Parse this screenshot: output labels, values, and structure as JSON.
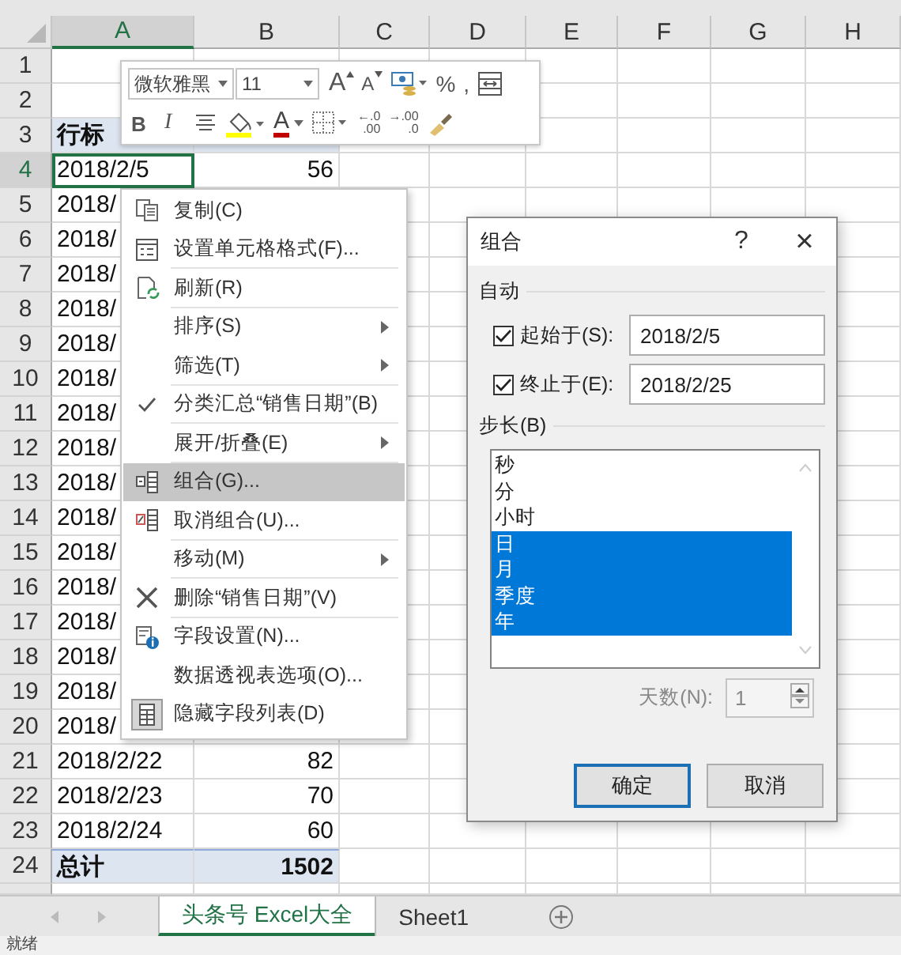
{
  "sheet": {
    "columns": [
      {
        "label": "A",
        "selected": true
      },
      {
        "label": "B",
        "selected": false
      },
      {
        "label": "C",
        "selected": false
      },
      {
        "label": "D",
        "selected": false
      },
      {
        "label": "E",
        "selected": false
      },
      {
        "label": "F",
        "selected": false
      },
      {
        "label": "G",
        "selected": false
      },
      {
        "label": "H",
        "selected": false
      }
    ],
    "rows": [
      {
        "number": "1",
        "kind": "data",
        "selected": false
      },
      {
        "number": "2",
        "kind": "data",
        "selected": false
      },
      {
        "number": "3",
        "kind": "header",
        "selected": false,
        "a": "行标"
      },
      {
        "number": "4",
        "kind": "data",
        "selected": true,
        "a": "2018/2/5",
        "b": "56"
      },
      {
        "number": "5",
        "kind": "data",
        "selected": false,
        "a": "2018/"
      },
      {
        "number": "6",
        "kind": "data",
        "selected": false,
        "a": "2018/"
      },
      {
        "number": "7",
        "kind": "data",
        "selected": false,
        "a": "2018/"
      },
      {
        "number": "8",
        "kind": "data",
        "selected": false,
        "a": "2018/"
      },
      {
        "number": "9",
        "kind": "data",
        "selected": false,
        "a": "2018/"
      },
      {
        "number": "10",
        "kind": "data",
        "selected": false,
        "a": "2018/"
      },
      {
        "number": "11",
        "kind": "data",
        "selected": false,
        "a": "2018/"
      },
      {
        "number": "12",
        "kind": "data",
        "selected": false,
        "a": "2018/"
      },
      {
        "number": "13",
        "kind": "data",
        "selected": false,
        "a": "2018/"
      },
      {
        "number": "14",
        "kind": "data",
        "selected": false,
        "a": "2018/"
      },
      {
        "number": "15",
        "kind": "data",
        "selected": false,
        "a": "2018/"
      },
      {
        "number": "16",
        "kind": "data",
        "selected": false,
        "a": "2018/"
      },
      {
        "number": "17",
        "kind": "data",
        "selected": false,
        "a": "2018/"
      },
      {
        "number": "18",
        "kind": "data",
        "selected": false,
        "a": "2018/"
      },
      {
        "number": "19",
        "kind": "data",
        "selected": false,
        "a": "2018/"
      },
      {
        "number": "20",
        "kind": "data",
        "selected": false,
        "a": "2018/"
      },
      {
        "number": "21",
        "kind": "data",
        "selected": false,
        "a": "2018/2/22",
        "b": "82"
      },
      {
        "number": "22",
        "kind": "data",
        "selected": false,
        "a": "2018/2/23",
        "b": "70"
      },
      {
        "number": "23",
        "kind": "data",
        "selected": false,
        "a": "2018/2/24",
        "b": "60"
      },
      {
        "number": "24",
        "kind": "total",
        "selected": false,
        "a": "总计",
        "b": "1502"
      }
    ]
  },
  "mini_toolbar": {
    "font": "微软雅黑",
    "size": "11",
    "row_1": [
      {
        "kind": "grow",
        "glyph": "A"
      },
      {
        "kind": "shrink",
        "glyph": "A"
      },
      {
        "kind": "currency"
      },
      {
        "kind": "text",
        "glyph": "%"
      },
      {
        "kind": "text",
        "glyph": ","
      },
      {
        "kind": "wrap"
      }
    ],
    "row_2": [
      {
        "kind": "bold",
        "glyph": "B"
      },
      {
        "kind": "italic",
        "glyph": "I"
      },
      {
        "kind": "align"
      },
      {
        "kind": "fill"
      },
      {
        "kind": "fontcolor",
        "glyph": "A"
      },
      {
        "kind": "border"
      },
      {
        "kind": "decimal",
        "top": ".0",
        "bottom": ".00",
        "arrow": "←"
      },
      {
        "kind": "decimal",
        "top": ".00",
        "bottom": ".0",
        "arrow": "→"
      },
      {
        "kind": "painter"
      }
    ]
  },
  "context_menu": [
    {
      "label": "复制(C)",
      "kind": "copy",
      "checked": false,
      "submenu": false,
      "selected": false,
      "separator_after": false
    },
    {
      "label": "设置单元格格式(F)...",
      "kind": "format",
      "checked": false,
      "submenu": false,
      "selected": false,
      "separator_after": true
    },
    {
      "label": "刷新(R)",
      "kind": "refresh",
      "checked": false,
      "submenu": false,
      "selected": false,
      "separator_after": true
    },
    {
      "label": "排序(S)",
      "kind": "plain",
      "checked": false,
      "submenu": true,
      "selected": false,
      "separator_after": false
    },
    {
      "label": "筛选(T)",
      "kind": "plain",
      "checked": false,
      "submenu": true,
      "selected": false,
      "separator_after": true
    },
    {
      "label": "分类汇总“销售日期”(B)",
      "kind": "plain",
      "checked": true,
      "submenu": false,
      "selected": false,
      "separator_after": true
    },
    {
      "label": "展开/折叠(E)",
      "kind": "plain",
      "checked": false,
      "submenu": true,
      "selected": false,
      "separator_after": true
    },
    {
      "label": "组合(G)...",
      "kind": "group",
      "checked": false,
      "submenu": false,
      "selected": true,
      "separator_after": false
    },
    {
      "label": "取消组合(U)...",
      "kind": "ungroup",
      "checked": false,
      "submenu": false,
      "selected": false,
      "separator_after": true
    },
    {
      "label": "移动(M)",
      "kind": "plain",
      "checked": false,
      "submenu": true,
      "selected": false,
      "separator_after": true
    },
    {
      "label": "删除“销售日期”(V)",
      "kind": "delete",
      "checked": false,
      "submenu": false,
      "selected": false,
      "separator_after": true
    },
    {
      "label": "字段设置(N)...",
      "kind": "field",
      "checked": false,
      "submenu": false,
      "selected": false,
      "separator_after": false
    },
    {
      "label": "数据透视表选项(O)...",
      "kind": "plain",
      "checked": false,
      "submenu": false,
      "selected": false,
      "separator_after": false
    },
    {
      "label": "隐藏字段列表(D)",
      "kind": "list",
      "checked": false,
      "submenu": false,
      "selected": false,
      "separator_after": false
    }
  ],
  "dialog": {
    "title": "组合",
    "help": "?",
    "close": "×",
    "auto_label": "自动",
    "start": {
      "label": "起始于(S):",
      "checked": true,
      "value": "2018/2/5"
    },
    "end": {
      "label": "终止于(E):",
      "checked": true,
      "value": "2018/2/25"
    },
    "step_label": "步长(B)",
    "steps": [
      {
        "label": "秒",
        "selected": false
      },
      {
        "label": "分",
        "selected": false
      },
      {
        "label": "小时",
        "selected": false
      },
      {
        "label": "日",
        "selected": true
      },
      {
        "label": "月",
        "selected": true
      },
      {
        "label": "季度",
        "selected": true
      },
      {
        "label": "年",
        "selected": true
      }
    ],
    "days": {
      "label": "天数(N):",
      "value": "1",
      "disabled": true
    },
    "buttons": [
      {
        "label": "确定",
        "default": true
      },
      {
        "label": "取消",
        "default": false
      }
    ]
  },
  "sheet_tabs": [
    {
      "label": "头条号 Excel大全",
      "selected": true
    },
    {
      "label": "Sheet1",
      "selected": false
    }
  ],
  "status_bar": "就绪"
}
